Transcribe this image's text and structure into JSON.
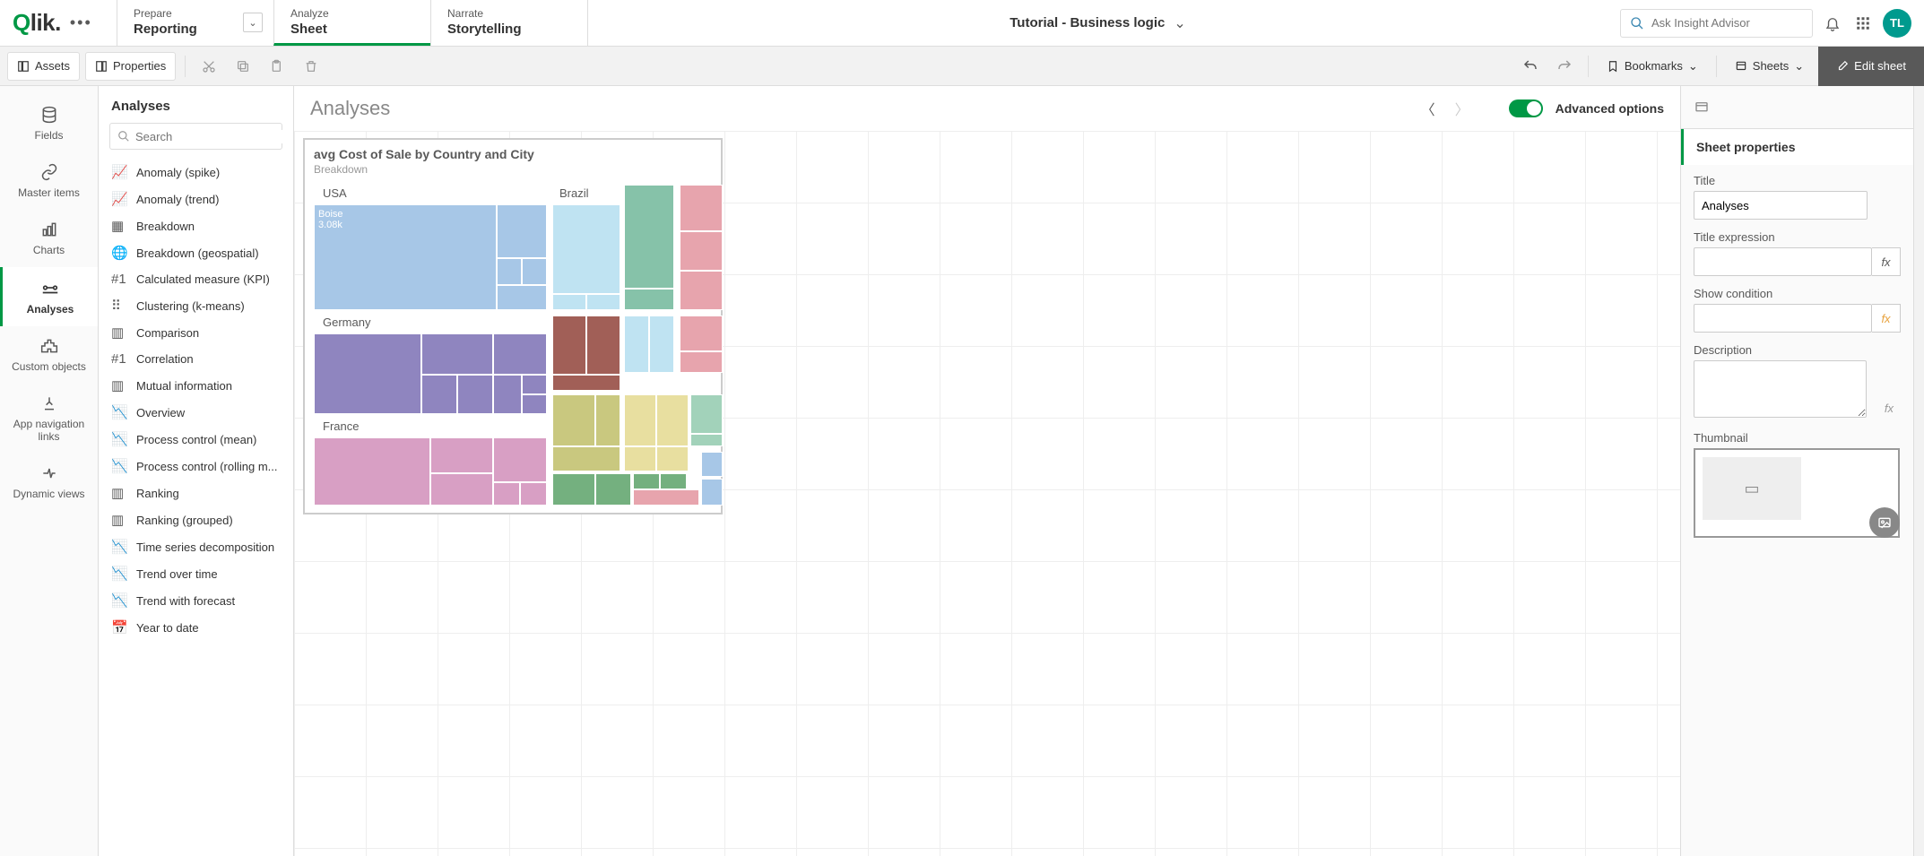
{
  "app": {
    "title": "Tutorial - Business logic",
    "user_initials": "TL"
  },
  "nav": {
    "prepare": {
      "small": "Prepare",
      "big": "Reporting"
    },
    "analyze": {
      "small": "Analyze",
      "big": "Sheet"
    },
    "narrate": {
      "small": "Narrate",
      "big": "Storytelling"
    }
  },
  "search": {
    "placeholder": "Ask Insight Advisor"
  },
  "toolbar": {
    "assets": "Assets",
    "properties": "Properties",
    "bookmarks": "Bookmarks",
    "sheets": "Sheets",
    "edit": "Edit sheet"
  },
  "rail": [
    {
      "label": "Fields",
      "icon": "db"
    },
    {
      "label": "Master items",
      "icon": "link"
    },
    {
      "label": "Charts",
      "icon": "chart"
    },
    {
      "label": "Analyses",
      "icon": "analyses",
      "active": true
    },
    {
      "label": "Custom objects",
      "icon": "puzzle"
    },
    {
      "label": "App navigation links",
      "icon": "navlink"
    },
    {
      "label": "Dynamic views",
      "icon": "dynamic"
    }
  ],
  "list": {
    "title": "Analyses",
    "search_placeholder": "Search",
    "items": [
      "Anomaly (spike)",
      "Anomaly (trend)",
      "Breakdown",
      "Breakdown (geospatial)",
      "Calculated measure (KPI)",
      "Clustering (k-means)",
      "Comparison",
      "Correlation",
      "Mutual information",
      "Overview",
      "Process control (mean)",
      "Process control (rolling m...",
      "Ranking",
      "Ranking (grouped)",
      "Time series decomposition",
      "Trend over time",
      "Trend with forecast",
      "Year to date"
    ]
  },
  "canvas": {
    "sheet_title": "Analyses",
    "advanced": "Advanced options",
    "chart": {
      "title": "avg Cost of Sale by Country and City",
      "subtitle": "Breakdown",
      "cell_label": "Boise",
      "cell_value": "3.08k",
      "countries": {
        "usa": "USA",
        "brazil": "Brazil",
        "germany": "Germany",
        "france": "France"
      }
    }
  },
  "props": {
    "header": "Sheet properties",
    "title_label": "Title",
    "title_value": "Analyses",
    "title_expr_label": "Title expression",
    "show_cond_label": "Show condition",
    "desc_label": "Description",
    "thumb_label": "Thumbnail"
  },
  "chart_data": {
    "type": "treemap",
    "title": "avg Cost of Sale by Country and City",
    "subtitle": "Breakdown",
    "hierarchy": [
      "Country",
      "City"
    ],
    "measure": "avg Cost of Sale",
    "visible_labels": [
      {
        "country": "USA",
        "city": "Boise",
        "value": 3080
      },
      {
        "country": "Brazil"
      },
      {
        "country": "Germany"
      },
      {
        "country": "France"
      }
    ],
    "colors": {
      "USA": "#a7c7e7",
      "Brazil": "#bfe3f2",
      "Germany": "#8f85bf",
      "France": "#d89fc4",
      "other1": "#86c2a9",
      "other2": "#e7a4ad",
      "other3": "#a15f57",
      "other4": "#c9c87f",
      "other5": "#e8dfa0",
      "other6": "#74b07f"
    }
  }
}
